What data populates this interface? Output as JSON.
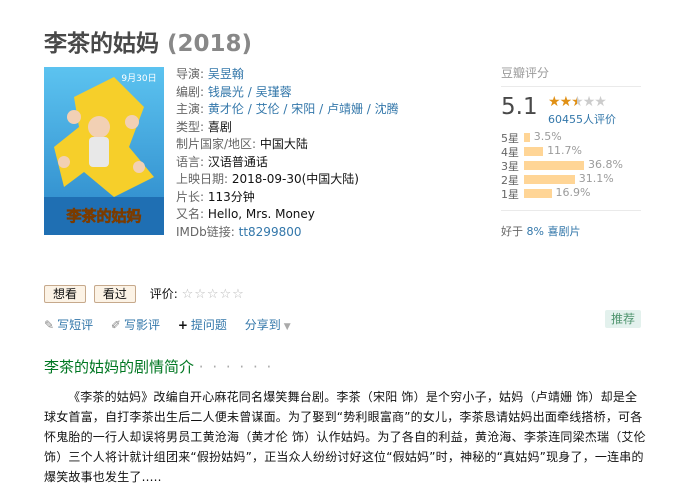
{
  "title": "李茶的姑妈",
  "year": "(2018)",
  "poster": {
    "date_text": "9月30日",
    "logo_text": "李茶的姑妈"
  },
  "info": {
    "director": {
      "label": "导演:",
      "names": [
        "吴昱翰"
      ]
    },
    "writer": {
      "label": "编剧:",
      "names": [
        "钱晨光",
        "吴瑾蓉"
      ]
    },
    "cast": {
      "label": "主演:",
      "names": [
        "黄才伦",
        "艾伦",
        "宋阳",
        "卢靖姗",
        "沈腾"
      ]
    },
    "genre": {
      "label": "类型:",
      "value": "喜剧"
    },
    "country": {
      "label": "制片国家/地区:",
      "value": "中国大陆"
    },
    "language": {
      "label": "语言:",
      "value": "汉语普通话"
    },
    "release": {
      "label": "上映日期:",
      "value": "2018-09-30(中国大陆)"
    },
    "runtime": {
      "label": "片长:",
      "value": "113分钟"
    },
    "aka": {
      "label": "又名:",
      "value": "Hello, Mrs. Money"
    },
    "imdb": {
      "label": "IMDb链接:",
      "value": "tt8299800"
    }
  },
  "rating": {
    "heading": "豆瓣评分",
    "score": "5.1",
    "stars_filled": 2.5,
    "votes": "60455人评价",
    "distribution": [
      {
        "label": "5星",
        "percent": 3.5,
        "text": "3.5%"
      },
      {
        "label": "4星",
        "percent": 11.7,
        "text": "11.7%"
      },
      {
        "label": "3星",
        "percent": 36.8,
        "text": "36.8%"
      },
      {
        "label": "2星",
        "percent": 31.1,
        "text": "31.1%"
      },
      {
        "label": "1星",
        "percent": 16.9,
        "text": "16.9%"
      }
    ],
    "better_than_prefix": "好于",
    "better_than_link": "8% 喜剧片"
  },
  "actions": {
    "want": "想看",
    "seen": "看过",
    "rate_label": "评价:",
    "rate_stars": "☆☆☆☆☆"
  },
  "links": {
    "short_review": "写短评",
    "review": "写影评",
    "ask": "提问题",
    "share": "分享到"
  },
  "recommend": "推荐",
  "summary": {
    "heading": "李茶的姑妈的剧情简介",
    "heading_dots": "· · · · · ·",
    "text": "《李茶的姑妈》改编自开心麻花同名爆笑舞台剧。李茶（宋阳 饰）是个穷小子，姑妈（卢靖姗 饰）却是全球女首富，自打李茶出生后二人便未曾谋面。为了娶到“势利眼富商”的女儿，李茶恳请姑妈出面牵线搭桥，可各怀鬼胎的一行人却误将男员工黄沧海（黄才伦 饰）认作姑妈。为了各自的利益，黄沧海、李茶连同梁杰瑞（艾伦 饰）三个人将计就计组团来“假扮姑妈”，正当众人纷纷讨好这位“假姑妈”时，神秘的“真姑妈”现身了，一连串的爆笑故事也发生了....."
  }
}
